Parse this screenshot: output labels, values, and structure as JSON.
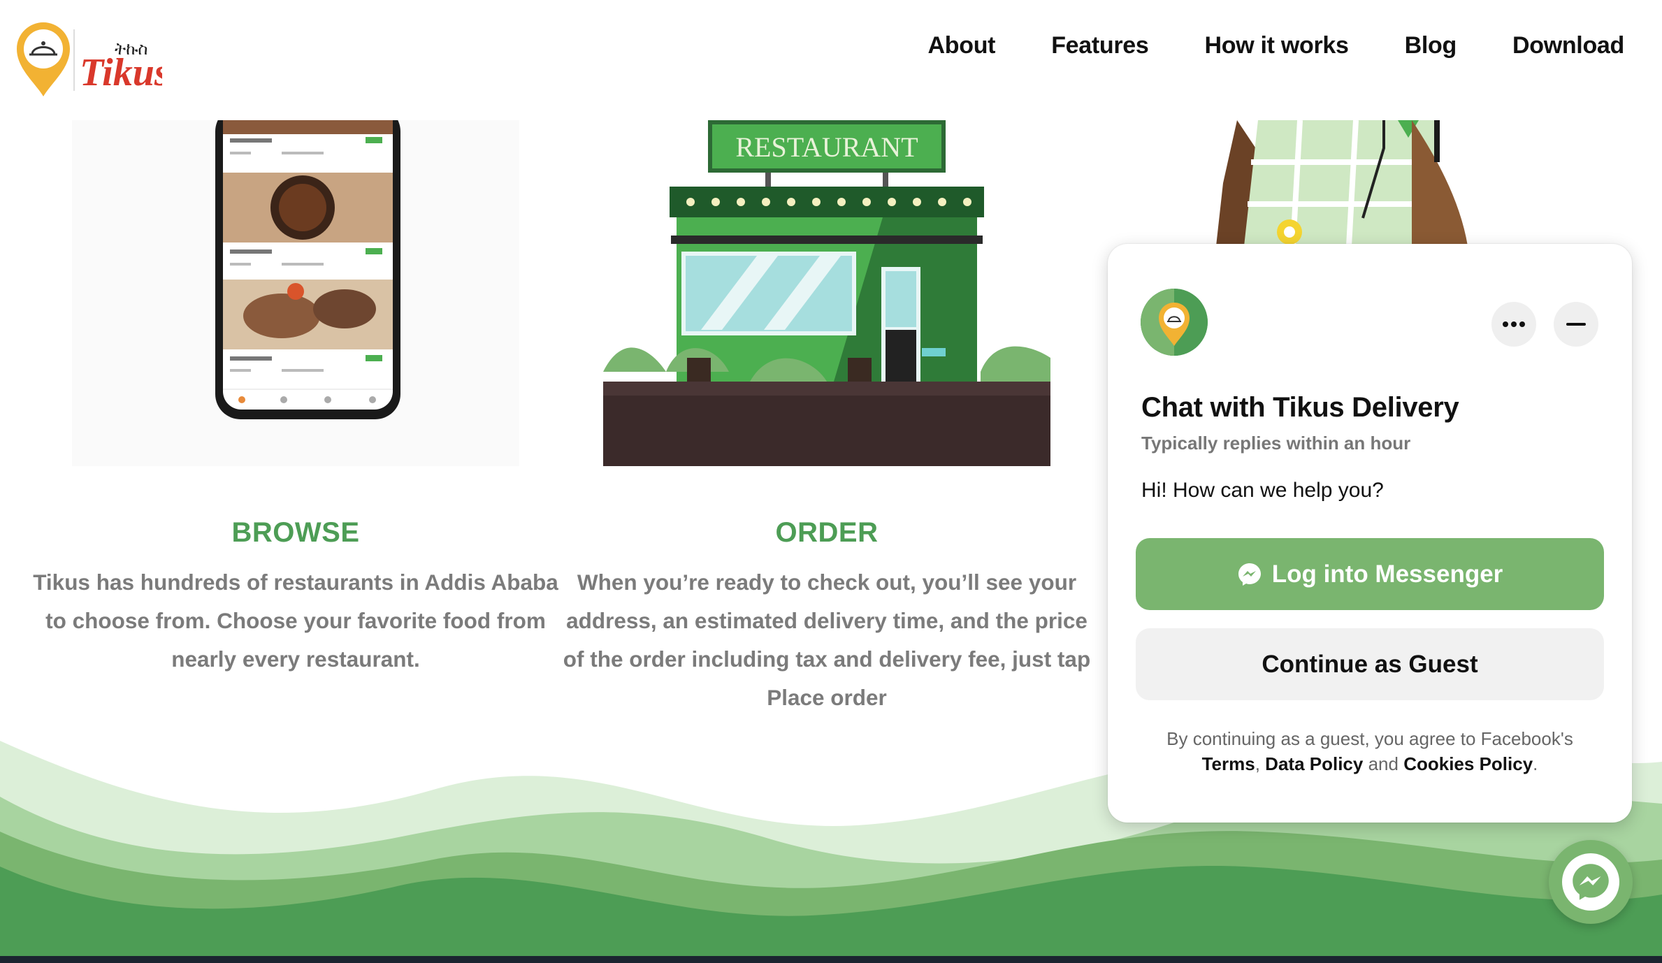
{
  "header": {
    "logo_text": "Tikus",
    "logo_script": "ትኩስ",
    "nav": [
      "About",
      "Features",
      "How it works",
      "Blog",
      "Download"
    ]
  },
  "columns": [
    {
      "title": "BROWSE",
      "text_lines": [
        "Tikus has hundreds of restaurants in Addis Ababa",
        "to choose from. Choose your favorite food from",
        "nearly every restaurant."
      ]
    },
    {
      "title": "ORDER",
      "sign": "RESTAURANT",
      "text_lines": [
        "When you’re ready to check out, you’ll see your",
        "address, an estimated delivery time, and the price",
        "of the order including tax and delivery fee, just tap",
        "Place order"
      ]
    }
  ],
  "chat": {
    "title": "Chat with Tikus Delivery",
    "subtitle": "Typically replies within an hour",
    "greeting": "Hi! How can we help you?",
    "messenger_button": "Log into Messenger",
    "guest_button": "Continue as Guest",
    "legal_prefix": "By continuing as a guest, you agree to Facebook's",
    "legal_terms": "Terms",
    "legal_comma": ",",
    "legal_data_policy": "Data Policy",
    "legal_and": "and",
    "legal_cookies": "Cookies Policy",
    "legal_period": "."
  },
  "colors": {
    "brand_green": "#4d9d55",
    "messenger_green": "#7ab56f"
  }
}
